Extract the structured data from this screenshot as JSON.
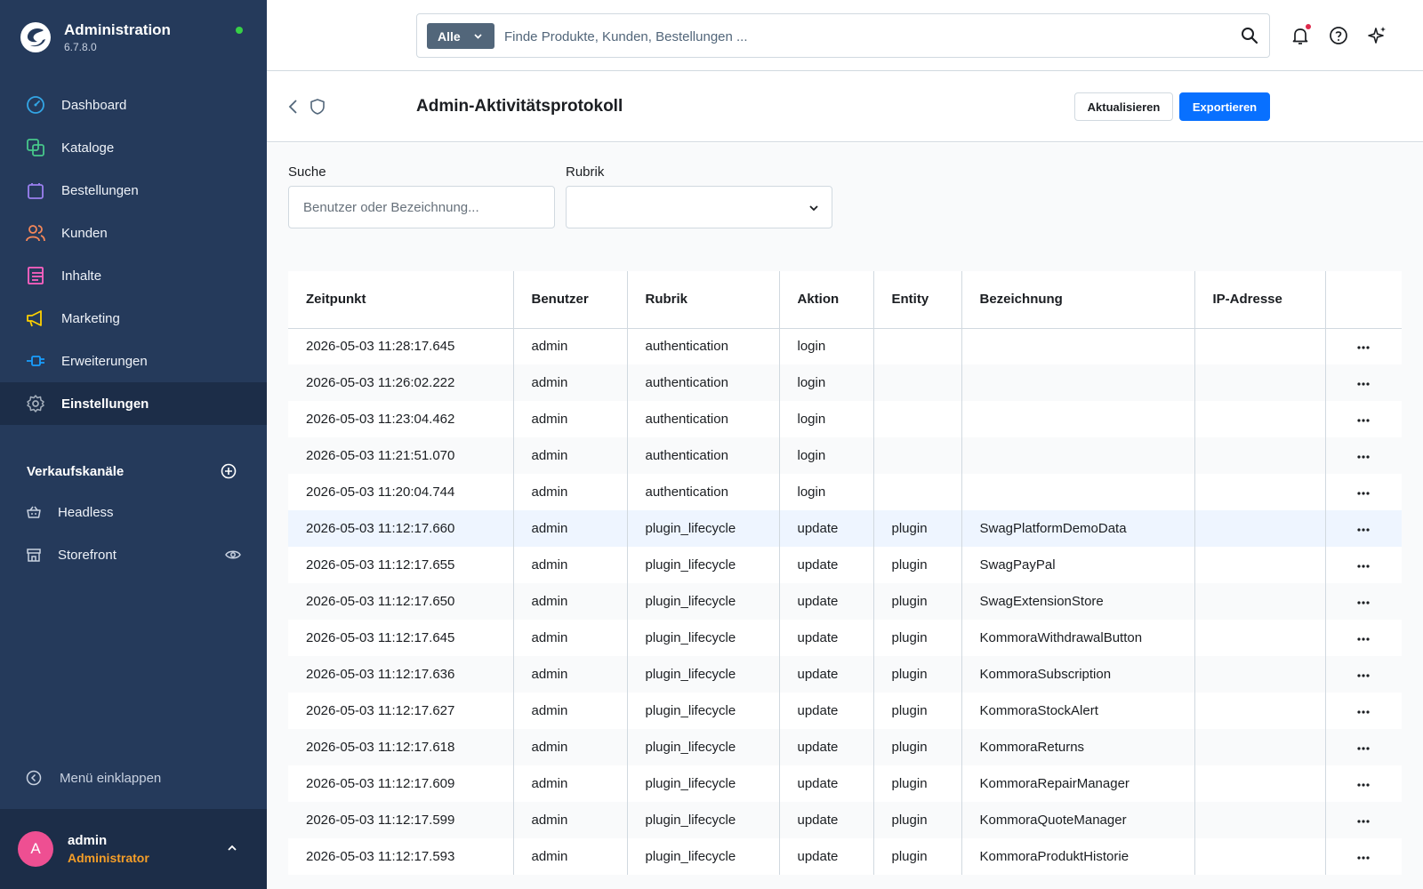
{
  "sidebar": {
    "brand_title": "Administration",
    "brand_version": "6.7.8.0",
    "items": [
      {
        "label": "Dashboard",
        "icon": "dashboard-icon",
        "color": "#33a6e6"
      },
      {
        "label": "Kataloge",
        "icon": "catalog-icon",
        "color": "#47c78b"
      },
      {
        "label": "Bestellungen",
        "icon": "shopping-bag-icon",
        "color": "#9b80f0"
      },
      {
        "label": "Kunden",
        "icon": "users-icon",
        "color": "#f58759"
      },
      {
        "label": "Inhalte",
        "icon": "content-icon",
        "color": "#ff62c4"
      },
      {
        "label": "Marketing",
        "icon": "megaphone-icon",
        "color": "#ffd000"
      },
      {
        "label": "Erweiterungen",
        "icon": "plug-icon",
        "color": "#189eff"
      },
      {
        "label": "Einstellungen",
        "icon": "gear-icon",
        "color": "#a2adba"
      }
    ],
    "sales_channels_heading": "Verkaufskanäle",
    "channels": [
      {
        "label": "Headless",
        "icon": "basket-icon"
      },
      {
        "label": "Storefront",
        "icon": "storefront-icon"
      }
    ],
    "collapse_label": "Menü einklappen",
    "user": {
      "initial": "A",
      "name": "admin",
      "role": "Administrator"
    }
  },
  "topbar": {
    "search_type": "Alle",
    "search_placeholder": "Finde Produkte, Kunden, Bestellungen ..."
  },
  "header": {
    "title": "Admin-Aktivitätsprotokoll",
    "refresh_label": "Aktualisieren",
    "export_label": "Exportieren"
  },
  "filters": {
    "search_label": "Suche",
    "search_placeholder": "Benutzer oder Bezeichnung...",
    "category_label": "Rubrik",
    "category_value": ""
  },
  "table": {
    "columns": [
      "Zeitpunkt",
      "Benutzer",
      "Rubrik",
      "Aktion",
      "Entity",
      "Bezeichnung",
      "IP-Adresse",
      ""
    ],
    "rows": [
      [
        "2026-05-03 11:28:17.645",
        "admin",
        "authentication",
        "login",
        "",
        "",
        ""
      ],
      [
        "2026-05-03 11:26:02.222",
        "admin",
        "authentication",
        "login",
        "",
        "",
        ""
      ],
      [
        "2026-05-03 11:23:04.462",
        "admin",
        "authentication",
        "login",
        "",
        "",
        ""
      ],
      [
        "2026-05-03 11:21:51.070",
        "admin",
        "authentication",
        "login",
        "",
        "",
        ""
      ],
      [
        "2026-05-03 11:20:04.744",
        "admin",
        "authentication",
        "login",
        "",
        "",
        ""
      ],
      [
        "2026-05-03 11:12:17.660",
        "admin",
        "plugin_lifecycle",
        "update",
        "plugin",
        "SwagPlatformDemoData",
        ""
      ],
      [
        "2026-05-03 11:12:17.655",
        "admin",
        "plugin_lifecycle",
        "update",
        "plugin",
        "SwagPayPal",
        ""
      ],
      [
        "2026-05-03 11:12:17.650",
        "admin",
        "plugin_lifecycle",
        "update",
        "plugin",
        "SwagExtensionStore",
        ""
      ],
      [
        "2026-05-03 11:12:17.645",
        "admin",
        "plugin_lifecycle",
        "update",
        "plugin",
        "KommoraWithdrawalButton",
        ""
      ],
      [
        "2026-05-03 11:12:17.636",
        "admin",
        "plugin_lifecycle",
        "update",
        "plugin",
        "KommoraSubscription",
        ""
      ],
      [
        "2026-05-03 11:12:17.627",
        "admin",
        "plugin_lifecycle",
        "update",
        "plugin",
        "KommoraStockAlert",
        ""
      ],
      [
        "2026-05-03 11:12:17.618",
        "admin",
        "plugin_lifecycle",
        "update",
        "plugin",
        "KommoraReturns",
        ""
      ],
      [
        "2026-05-03 11:12:17.609",
        "admin",
        "plugin_lifecycle",
        "update",
        "plugin",
        "KommoraRepairManager",
        ""
      ],
      [
        "2026-05-03 11:12:17.599",
        "admin",
        "plugin_lifecycle",
        "update",
        "plugin",
        "KommoraQuoteManager",
        ""
      ],
      [
        "2026-05-03 11:12:17.593",
        "admin",
        "plugin_lifecycle",
        "update",
        "plugin",
        "KommoraProduktHistorie",
        ""
      ]
    ],
    "highlighted_row": 5
  },
  "colors": {
    "sidebar_bg": "#253a5b",
    "primary": "#0870ff",
    "online": "#37d046",
    "role": "#f59e28",
    "avatar": "#ee4f92"
  }
}
